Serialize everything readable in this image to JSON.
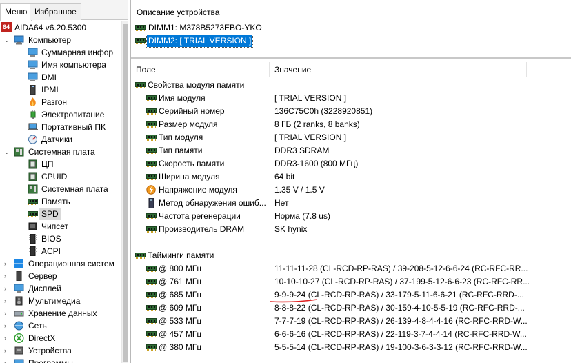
{
  "tabs": {
    "menu": "Меню",
    "favorites": "Избранное"
  },
  "tree": {
    "app": "AIDA64 v6.20.5300",
    "app_badge": "64",
    "computer": {
      "label": "Компьютер",
      "children": [
        "Суммарная инфор",
        "Имя компьютера",
        "DMI",
        "IPMI",
        "Разгон",
        "Электропитание",
        "Портативный ПК",
        "Датчики"
      ]
    },
    "motherboard": {
      "label": "Системная плата",
      "children": [
        "ЦП",
        "CPUID",
        "Системная плата",
        "Память",
        "SPD",
        "Чипсет",
        "BIOS",
        "ACPI"
      ]
    },
    "others": [
      "Операционная систем",
      "Сервер",
      "Дисплей",
      "Мультимедиа",
      "Хранение данных",
      "Сеть",
      "DirectX",
      "Устройства",
      "Программы"
    ]
  },
  "device_panel": {
    "header": "Описание устройства",
    "items": [
      "DIMM1: M378B5273EBO-YKO",
      "DIMM2: [ TRIAL VERSION ]"
    ]
  },
  "grid": {
    "columns": {
      "field": "Поле",
      "value": "Значение"
    },
    "section1": "Свойства модуля памяти",
    "props": [
      {
        "name": "Имя модуля",
        "value": "[ TRIAL VERSION ]",
        "icon": "ram-icon"
      },
      {
        "name": "Серийный номер",
        "value": "136C75C0h (3228920851)",
        "icon": "ram-icon"
      },
      {
        "name": "Размер модуля",
        "value": "8 ГБ (2 ranks, 8 banks)",
        "icon": "ram-icon"
      },
      {
        "name": "Тип модуля",
        "value": "[ TRIAL VERSION ]",
        "icon": "ram-icon"
      },
      {
        "name": "Тип памяти",
        "value": "DDR3 SDRAM",
        "icon": "ram-icon"
      },
      {
        "name": "Скорость памяти",
        "value": "DDR3-1600 (800 МГц)",
        "icon": "ram-icon"
      },
      {
        "name": "Ширина модуля",
        "value": "64 bit",
        "icon": "ram-icon"
      },
      {
        "name": "Напряжение модуля",
        "value": "1.35 V / 1.5 V",
        "icon": "voltage-icon"
      },
      {
        "name": "Метод обнаружения ошиб...",
        "value": "Нет",
        "icon": "device-icon"
      },
      {
        "name": "Частота регенерации",
        "value": "Норма (7.8 us)",
        "icon": "ram-icon"
      },
      {
        "name": "Производитель DRAM",
        "value": "SK hynix",
        "icon": "ram-icon"
      }
    ],
    "section2": "Тайминги памяти",
    "timings": [
      {
        "name": "@ 800 МГц",
        "value": "11-11-11-28  (CL-RCD-RP-RAS) / 39-208-5-12-6-6-24  (RC-RFC-RR..."
      },
      {
        "name": "@ 761 МГц",
        "value": "10-10-10-27  (CL-RCD-RP-RAS) / 37-199-5-12-6-6-23  (RC-RFC-RR..."
      },
      {
        "name": "@ 685 МГц",
        "value": "9-9-9-24  (CL-RCD-RP-RAS) / 33-179-5-11-6-6-21  (RC-RFC-RRD-..."
      },
      {
        "name": "@ 609 МГц",
        "value": "8-8-8-22  (CL-RCD-RP-RAS) / 30-159-4-10-5-5-19  (RC-RFC-RRD-..."
      },
      {
        "name": "@ 533 МГц",
        "value": "7-7-7-19  (CL-RCD-RP-RAS) / 26-139-4-8-4-4-16  (RC-RFC-RRD-W..."
      },
      {
        "name": "@ 457 МГц",
        "value": "6-6-6-16  (CL-RCD-RP-RAS) / 22-119-3-7-4-4-14  (RC-RFC-RRD-W..."
      },
      {
        "name": "@ 380 МГц",
        "value": "5-5-5-14  (CL-RCD-RP-RAS) / 19-100-3-6-3-3-12  (RC-RFC-RRD-W..."
      }
    ]
  },
  "colors": {
    "selection": "#0078d7",
    "annotation_line": "#e02020",
    "ram_green": "#2f6b34"
  }
}
